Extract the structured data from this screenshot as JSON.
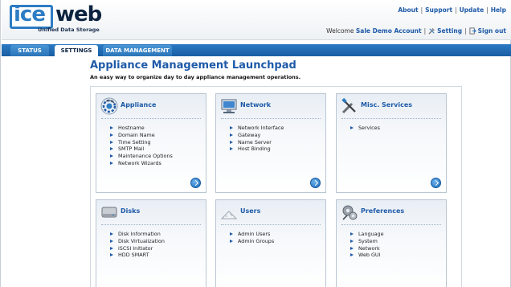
{
  "brand": {
    "logo_ice": "ice",
    "logo_web": "web",
    "logo_subtitle": "Unified Data Storage"
  },
  "top_links": {
    "about": "About",
    "support": "Support",
    "update": "Update",
    "help": "Help",
    "separator": "|"
  },
  "user_bar": {
    "welcome": "Welcome",
    "account_name": "Sale Demo Account",
    "setting": "Setting",
    "sign_out": "Sign out",
    "separator": "|"
  },
  "tabs": [
    {
      "label": "STATUS"
    },
    {
      "label": "SETTINGS"
    },
    {
      "label": "DATA MANAGEMENT"
    }
  ],
  "page": {
    "title": "Appliance Management Launchpad",
    "subtitle": "An easy way to organize day to day appliance management operations."
  },
  "cards": [
    {
      "title": "Appliance",
      "icon": "appliance-icon",
      "items": [
        "Hostname",
        "Domain Name",
        "Time Setting",
        "SMTP Mail",
        "Maintenance Options",
        "Network Wizards"
      ]
    },
    {
      "title": "Network",
      "icon": "network-icon",
      "items": [
        "Network Interface",
        "Gateway",
        "Name Server",
        "Host Binding"
      ]
    },
    {
      "title": "Misc. Services",
      "icon": "tools-icon",
      "items": [
        "Services"
      ]
    },
    {
      "title": "Disks",
      "icon": "disk-icon",
      "items": [
        "Disk Information",
        "Disk Virtualization",
        "iSCSI Initiator",
        "HDD SMART"
      ]
    },
    {
      "title": "Users",
      "icon": "users-icon",
      "items": [
        "Admin Users",
        "Admin Groups"
      ]
    },
    {
      "title": "Preferences",
      "icon": "preferences-icon",
      "items": [
        "Language",
        "System",
        "Network",
        "Web GUI"
      ]
    }
  ],
  "colors": {
    "accent": "#1e5aa8",
    "tabbar": "#1a5ea3",
    "logo_blue": "#2d7cc4",
    "logo_dark": "#0c2340"
  }
}
